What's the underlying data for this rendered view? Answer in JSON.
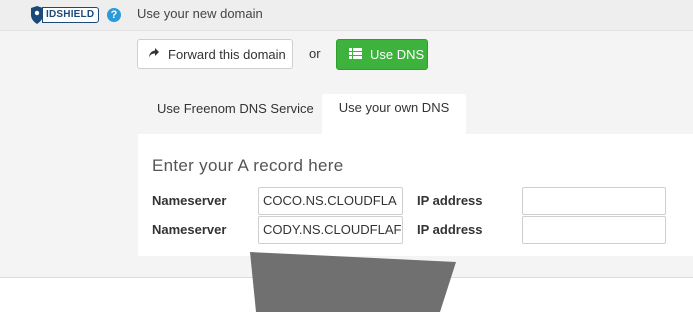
{
  "header": {
    "logo_text": "IDSHIELD",
    "help_icon": "?",
    "title": "Use your new domain"
  },
  "actions": {
    "forward_label": "Forward this domain",
    "forward_icon": "share-arrow-icon",
    "or_label": "or",
    "dns_label": "Use DNS",
    "dns_icon": "list-icon",
    "dns_color": "#3db33d"
  },
  "tabs": [
    {
      "label": "Use Freenom DNS Service",
      "active": false
    },
    {
      "label": "Use your own DNS",
      "active": true
    }
  ],
  "panel": {
    "title": "Enter your A record here",
    "rows": [
      {
        "label": "Nameserver",
        "value": "COCO.NS.CLOUDFLA",
        "ip_label": "IP address",
        "ip_value": ""
      },
      {
        "label": "Nameserver",
        "value": "CODY.NS.CLOUDFLAF",
        "ip_label": "IP address",
        "ip_value": ""
      }
    ]
  }
}
